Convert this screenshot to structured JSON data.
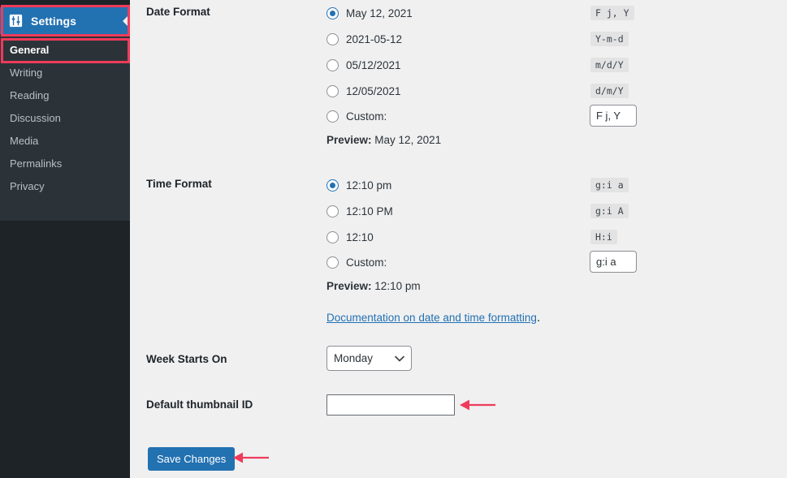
{
  "sidebar": {
    "menu": {
      "label": "Settings",
      "icon": "settings-sliders-icon",
      "collapse_icon": "collapse-left-arrow-icon",
      "active_color": "#2271b1"
    },
    "submenu_items": [
      {
        "label": "General",
        "current": true
      },
      {
        "label": "Writing",
        "current": false
      },
      {
        "label": "Reading",
        "current": false
      },
      {
        "label": "Discussion",
        "current": false
      },
      {
        "label": "Media",
        "current": false
      },
      {
        "label": "Permalinks",
        "current": false
      },
      {
        "label": "Privacy",
        "current": false
      }
    ],
    "background": "#1d2327",
    "submenu_background": "#2c3338"
  },
  "annotations": {
    "color": "#ef3b5b",
    "boxes": [
      "settings-menu-item",
      "general-submenu-item"
    ],
    "arrows": [
      "default-thumbnail-id-field",
      "save-changes-button"
    ]
  },
  "date_format": {
    "label": "Date Format",
    "options": [
      {
        "text": "May 12, 2021",
        "code": "F j, Y",
        "checked": true
      },
      {
        "text": "2021-05-12",
        "code": "Y-m-d",
        "checked": false
      },
      {
        "text": "05/12/2021",
        "code": "m/d/Y",
        "checked": false
      },
      {
        "text": "12/05/2021",
        "code": "d/m/Y",
        "checked": false
      }
    ],
    "custom_label": "Custom:",
    "custom_checked": false,
    "custom_value": "F j, Y",
    "preview_label": "Preview:",
    "preview_value": "May 12, 2021"
  },
  "time_format": {
    "label": "Time Format",
    "options": [
      {
        "text": "12:10 pm",
        "code": "g:i a",
        "checked": true
      },
      {
        "text": "12:10 PM",
        "code": "g:i A",
        "checked": false
      },
      {
        "text": "12:10",
        "code": "H:i",
        "checked": false
      }
    ],
    "custom_label": "Custom:",
    "custom_checked": false,
    "custom_value": "g:i a",
    "preview_label": "Preview:",
    "preview_value": "12:10 pm",
    "doc_link_text": "Documentation on date and time formatting",
    "doc_link_tail": "."
  },
  "week_starts_on": {
    "label": "Week Starts On",
    "selected": "Monday",
    "caret_icon": "chevron-down-icon"
  },
  "default_thumbnail": {
    "label": "Default thumbnail ID",
    "value": "",
    "placeholder": ""
  },
  "save": {
    "label": "Save Changes"
  }
}
